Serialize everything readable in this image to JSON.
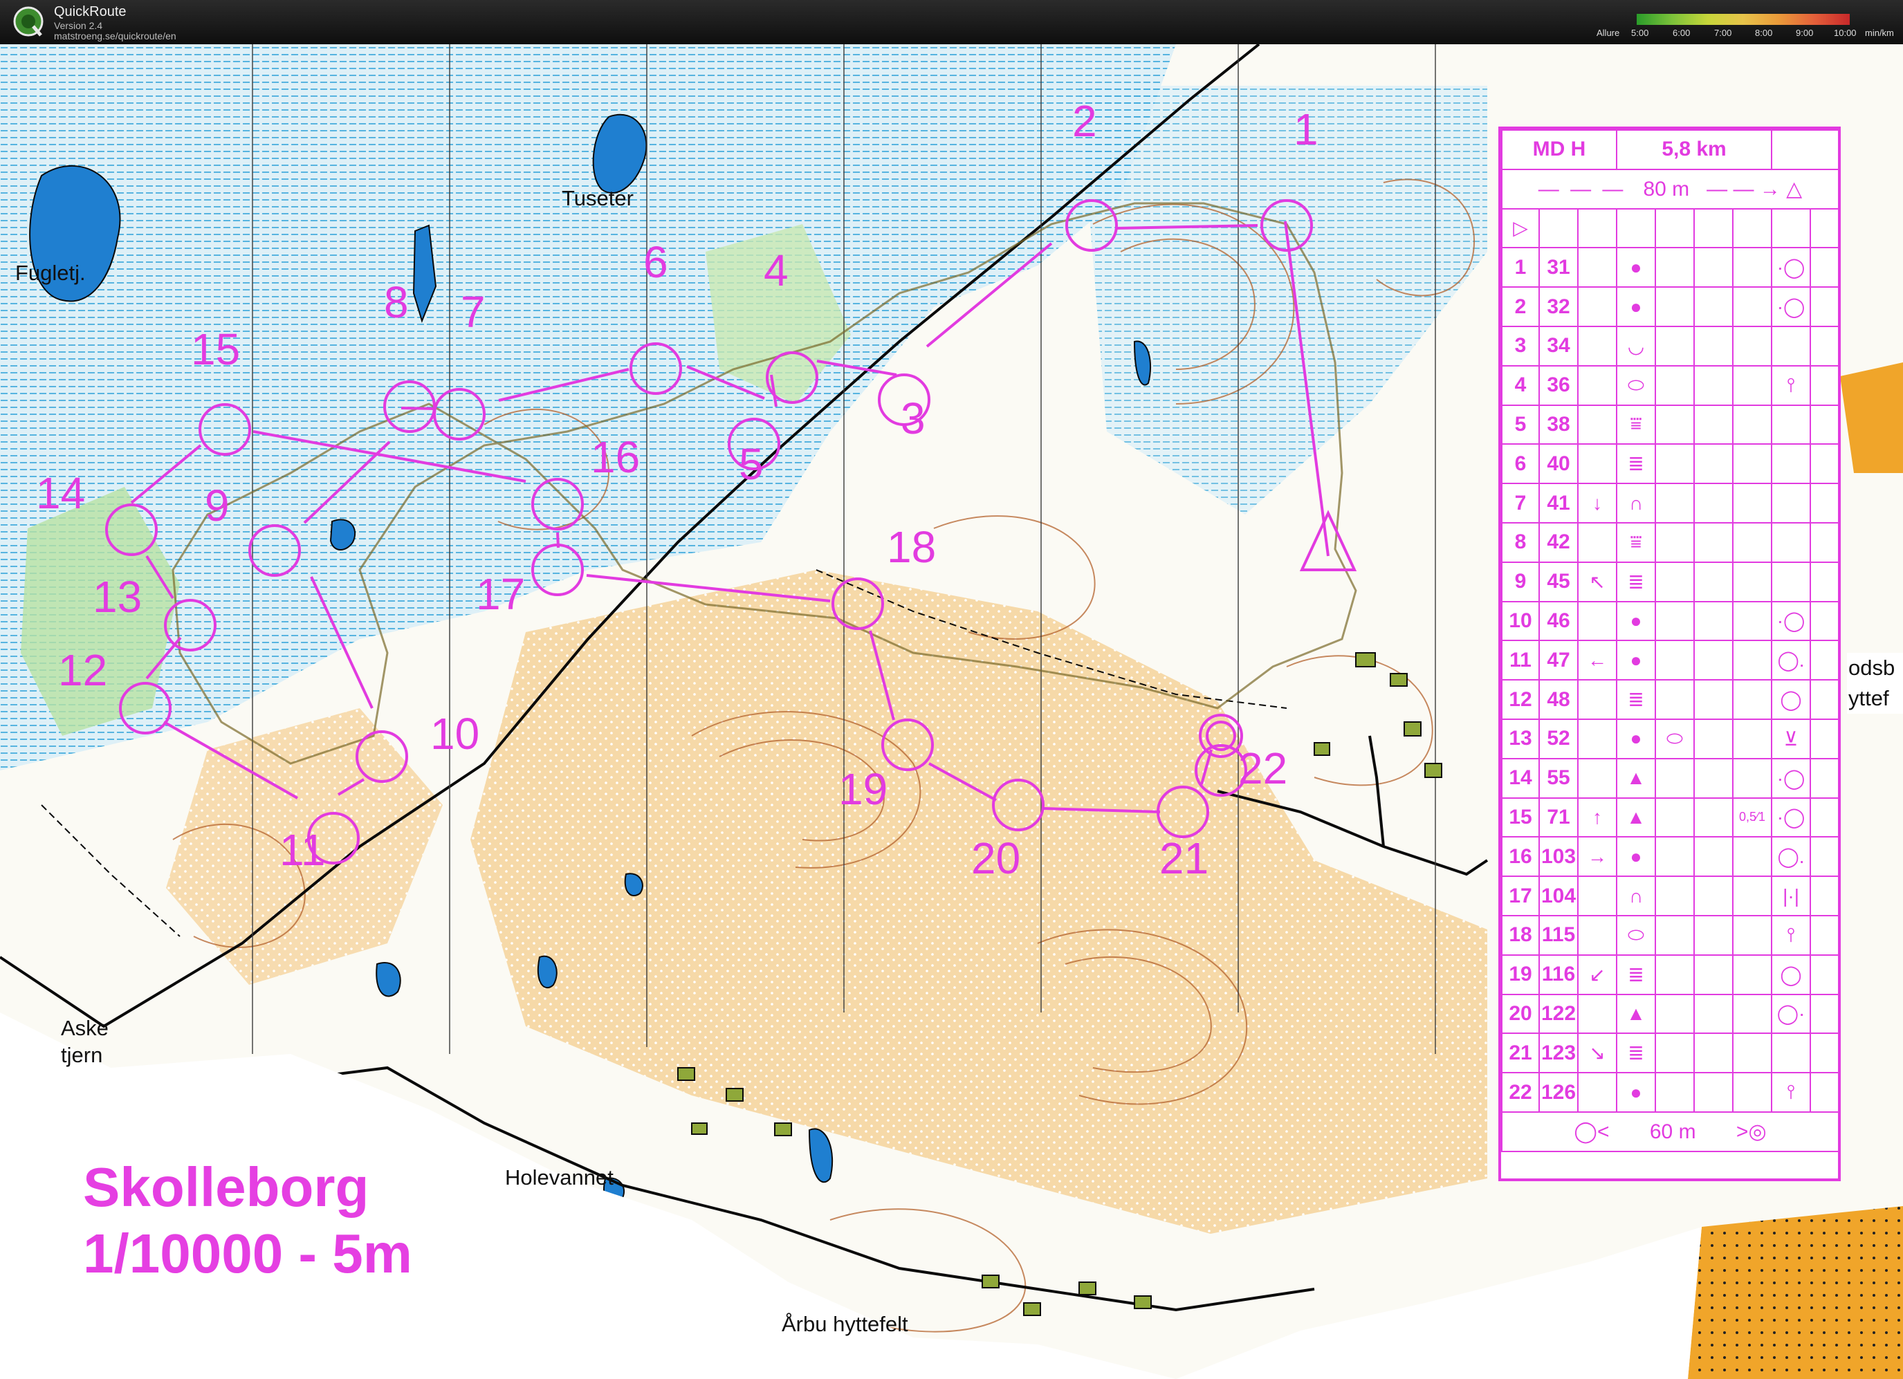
{
  "app": {
    "name": "QuickRoute",
    "version": "Version 2.4",
    "url": "matstroeng.se/quickroute/en"
  },
  "pace_legend": {
    "label": "Allure",
    "ticks": [
      "5:00",
      "6:00",
      "7:00",
      "8:00",
      "9:00",
      "10:00",
      "min/km"
    ]
  },
  "map": {
    "title_line1": "Skolleborg",
    "title_line2": "1/10000 - 5m",
    "place_names": [
      "Fugletj.",
      "Tuseter",
      "Aske\ntjern",
      "Holevannet",
      "Årbu hyttefelt"
    ],
    "edge_text_right": [
      "odsb",
      "yttef"
    ],
    "control_numbers": [
      "1",
      "2",
      "3",
      "4",
      "5",
      "6",
      "7",
      "8",
      "9",
      "10",
      "11",
      "12",
      "13",
      "14",
      "15",
      "16",
      "17",
      "18",
      "19",
      "20",
      "21",
      "22"
    ],
    "course_color": "#e23be0",
    "colors": {
      "open_land": "#f3cf97",
      "marsh_water": "#3aa8dc",
      "lake": "#1f7fd0",
      "forest": "#ffffff",
      "green": "#9fd88a",
      "contour": "#b4622c",
      "route": "#7a6a2a"
    }
  },
  "description_sheet": {
    "class": "MD H",
    "length": "5,8 km",
    "start_to_first": "80 m",
    "finish_distance": "60 m",
    "controls": [
      {
        "num": "1",
        "code": "31",
        "dir": "",
        "feature": "●",
        "appearance": "",
        "detail": "",
        "location": "·◯"
      },
      {
        "num": "2",
        "code": "32",
        "dir": "",
        "feature": "●",
        "appearance": "",
        "detail": "",
        "location": "·◯"
      },
      {
        "num": "3",
        "code": "34",
        "dir": "",
        "feature": "◡",
        "appearance": "",
        "detail": "",
        "location": ""
      },
      {
        "num": "4",
        "code": "36",
        "dir": "",
        "feature": "⬭",
        "appearance": "",
        "detail": "",
        "location": "⫯"
      },
      {
        "num": "5",
        "code": "38",
        "dir": "",
        "feature": "⩸",
        "appearance": "",
        "detail": "",
        "location": ""
      },
      {
        "num": "6",
        "code": "40",
        "dir": "",
        "feature": "≣",
        "appearance": "",
        "detail": "",
        "location": ""
      },
      {
        "num": "7",
        "code": "41",
        "dir": "↓",
        "feature": "∩",
        "appearance": "",
        "detail": "",
        "location": ""
      },
      {
        "num": "8",
        "code": "42",
        "dir": "",
        "feature": "⩸",
        "appearance": "",
        "detail": "",
        "location": ""
      },
      {
        "num": "9",
        "code": "45",
        "dir": "↖",
        "feature": "≣",
        "appearance": "",
        "detail": "",
        "location": ""
      },
      {
        "num": "10",
        "code": "46",
        "dir": "",
        "feature": "●",
        "appearance": "",
        "detail": "",
        "location": "·◯"
      },
      {
        "num": "11",
        "code": "47",
        "dir": "←",
        "feature": "●",
        "appearance": "",
        "detail": "",
        "location": "◯."
      },
      {
        "num": "12",
        "code": "48",
        "dir": "",
        "feature": "≣",
        "appearance": "",
        "detail": "",
        "location": "◯"
      },
      {
        "num": "13",
        "code": "52",
        "dir": "",
        "feature": "●",
        "appearance": "⬭",
        "detail": "",
        "location": "⊻"
      },
      {
        "num": "14",
        "code": "55",
        "dir": "",
        "feature": "▲",
        "appearance": "",
        "detail": "",
        "location": "·◯"
      },
      {
        "num": "15",
        "code": "71",
        "dir": "↑",
        "feature": "▲",
        "appearance": "",
        "detail": "0,5⁄1",
        "location": "·◯"
      },
      {
        "num": "16",
        "code": "103",
        "dir": "→",
        "feature": "●",
        "appearance": "",
        "detail": "",
        "location": "◯."
      },
      {
        "num": "17",
        "code": "104",
        "dir": "",
        "feature": "∩",
        "appearance": "",
        "detail": "",
        "location": "|·|"
      },
      {
        "num": "18",
        "code": "115",
        "dir": "",
        "feature": "⬭",
        "appearance": "",
        "detail": "",
        "location": "⫯"
      },
      {
        "num": "19",
        "code": "116",
        "dir": "↙",
        "feature": "≣",
        "appearance": "",
        "detail": "",
        "location": "◯"
      },
      {
        "num": "20",
        "code": "122",
        "dir": "",
        "feature": "▲",
        "appearance": "",
        "detail": "",
        "location": "◯·"
      },
      {
        "num": "21",
        "code": "123",
        "dir": "↘",
        "feature": "≣",
        "appearance": "",
        "detail": "",
        "location": ""
      },
      {
        "num": "22",
        "code": "126",
        "dir": "",
        "feature": "●",
        "appearance": "",
        "detail": "",
        "location": "⫯"
      }
    ]
  }
}
